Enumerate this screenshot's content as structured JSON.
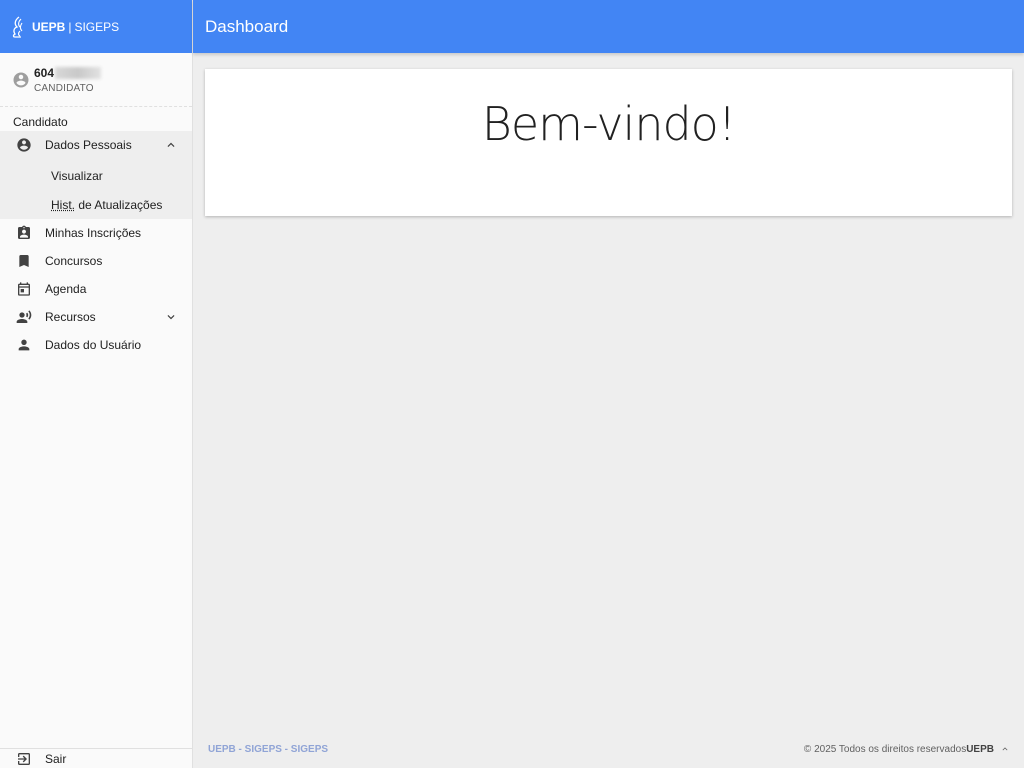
{
  "brand": {
    "name": "UEPB",
    "separator": "|",
    "product": "SIGEPS"
  },
  "user": {
    "id_prefix": "604",
    "role": "CANDIDATO"
  },
  "sidebar": {
    "section": "Candidato",
    "items": [
      {
        "label": "Dados Pessoais",
        "icon": "account-circle-icon",
        "expanded": true,
        "children": [
          {
            "label": "Visualizar"
          },
          {
            "abbr": "Hist.",
            "rest": " de Atualizações"
          }
        ]
      },
      {
        "label": "Minhas Inscrições",
        "icon": "assignment-ind-icon"
      },
      {
        "label": "Concursos",
        "icon": "bookmark-icon"
      },
      {
        "label": "Agenda",
        "icon": "calendar-icon"
      },
      {
        "label": "Recursos",
        "icon": "record-voice-icon",
        "expanded": false
      },
      {
        "label": "Dados do Usuário",
        "icon": "person-icon"
      }
    ],
    "logout": {
      "label": "Sair",
      "icon": "exit-icon"
    }
  },
  "header": {
    "title": "Dashboard"
  },
  "main": {
    "welcome": "Bem-vindo!"
  },
  "footer": {
    "left": "UEPB - SIGEPS - SIGEPS",
    "copyright": "© 2025 Todos os direitos reservados",
    "brand": "UEPB"
  },
  "colors": {
    "primary": "#4285f4",
    "sidebar_bg": "#fafafa",
    "page_bg": "#eeeeee",
    "footer_link": "#90a4d6"
  }
}
